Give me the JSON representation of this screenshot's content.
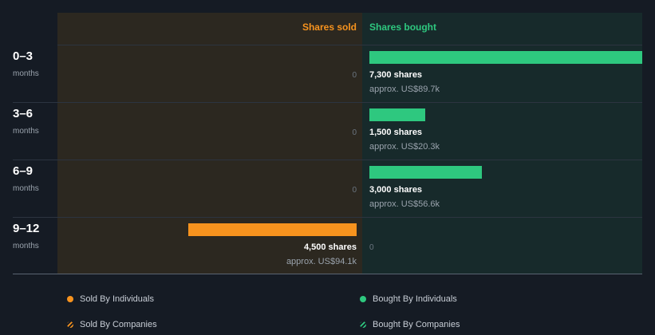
{
  "headers": {
    "sold": "Shares sold",
    "bought": "Shares bought"
  },
  "colors": {
    "sold": "#f7931e",
    "bought": "#2ec87f"
  },
  "rows": [
    {
      "period": "0–3",
      "unit": "months",
      "sold_zero": "0",
      "bought_shares": "7,300 shares",
      "bought_approx": "approx. US$89.7k"
    },
    {
      "period": "3–6",
      "unit": "months",
      "sold_zero": "0",
      "bought_shares": "1,500 shares",
      "bought_approx": "approx. US$20.3k"
    },
    {
      "period": "6–9",
      "unit": "months",
      "sold_zero": "0",
      "bought_shares": "3,000 shares",
      "bought_approx": "approx. US$56.6k"
    },
    {
      "period": "9–12",
      "unit": "months",
      "sold_shares": "4,500 shares",
      "sold_approx": "approx. US$94.1k",
      "bought_zero": "0"
    }
  ],
  "legend": {
    "sold_individuals": "Sold By Individuals",
    "bought_individuals": "Bought By Individuals",
    "sold_companies": "Sold By Companies",
    "bought_companies": "Bought By Companies"
  },
  "chart_data": {
    "type": "bar",
    "categories": [
      "0–3 months",
      "3–6 months",
      "6–9 months",
      "9–12 months"
    ],
    "series": [
      {
        "name": "Shares sold",
        "values": [
          0,
          0,
          0,
          4500
        ]
      },
      {
        "name": "Shares bought",
        "values": [
          7300,
          1500,
          3000,
          0
        ]
      }
    ],
    "value_labels_usd": {
      "sold": [
        null,
        null,
        null,
        94100
      ],
      "bought": [
        89700,
        20300,
        56600,
        null
      ]
    },
    "xlim": [
      0,
      7300
    ],
    "legend_position": "bottom"
  }
}
